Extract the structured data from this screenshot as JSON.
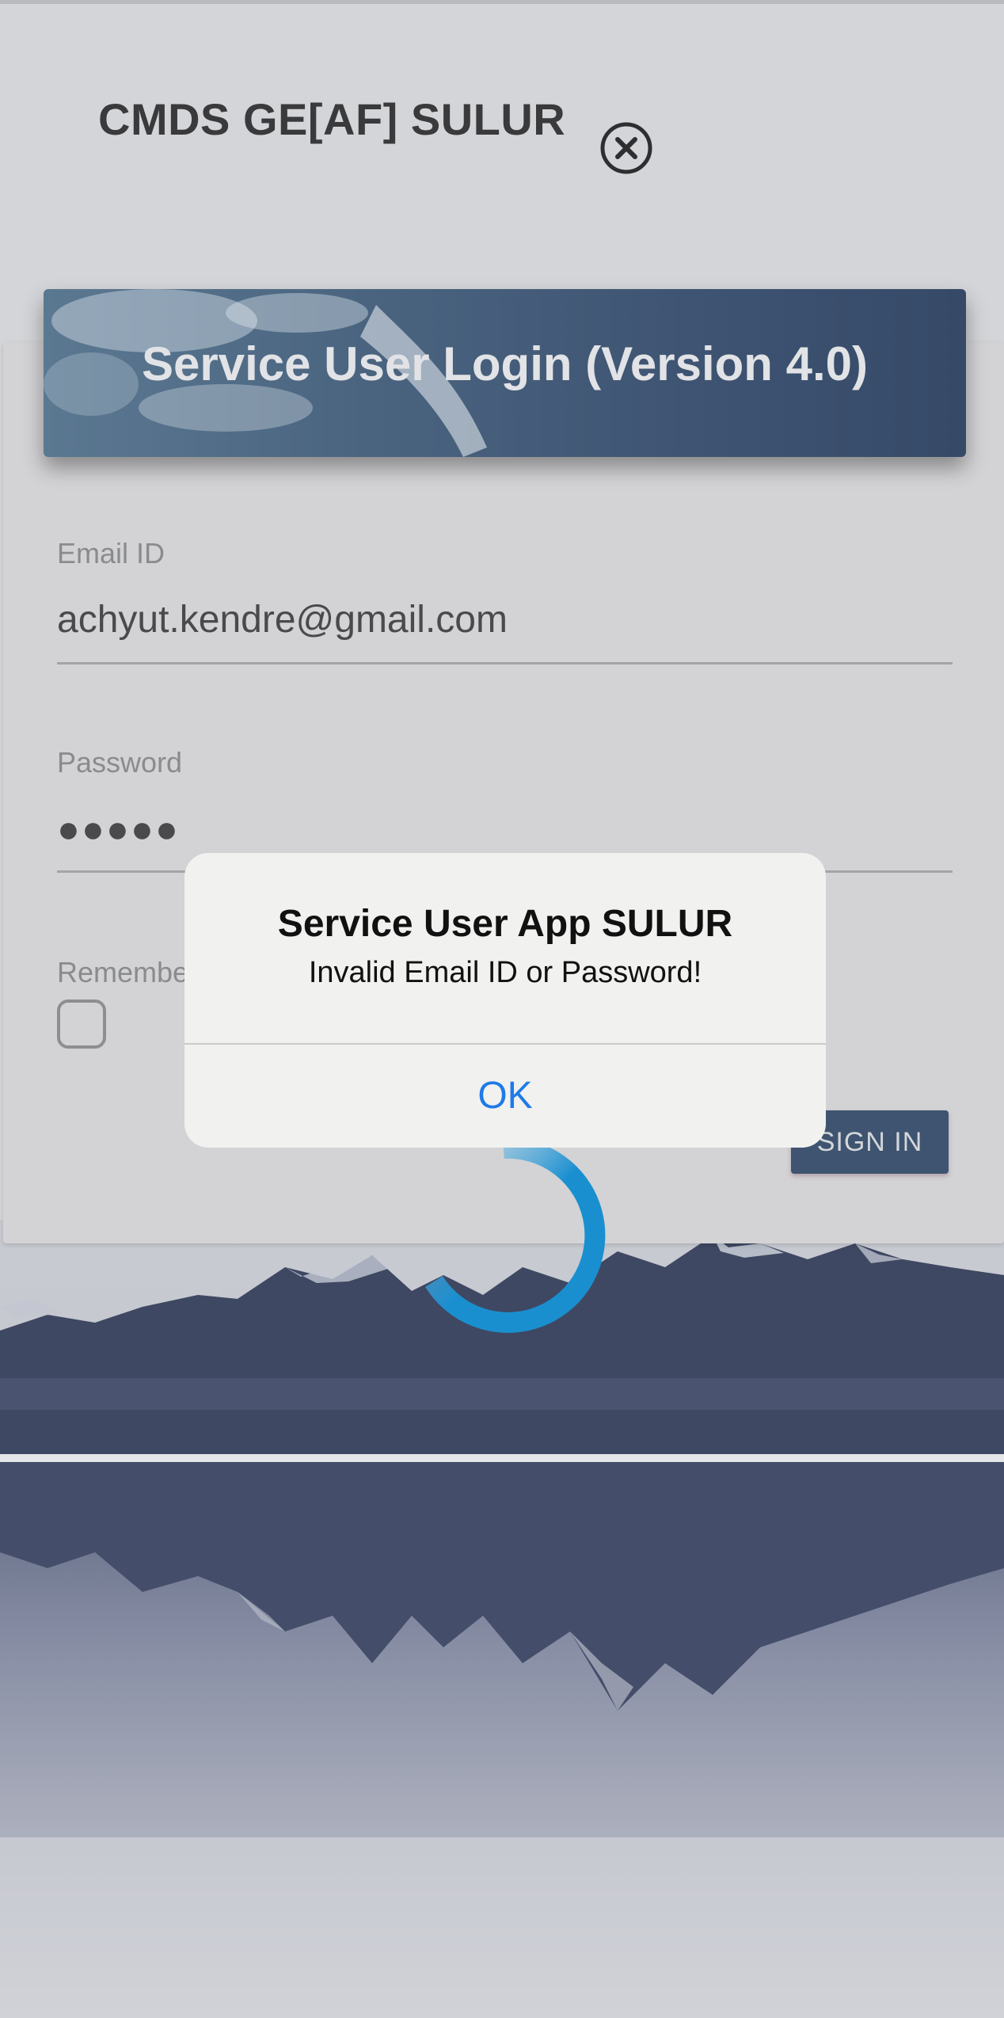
{
  "header": {
    "title": "CMDS GE[AF] SULUR",
    "close_icon": "close-circle-icon"
  },
  "login_card": {
    "banner_title": "Service User Login (Version 4.0)",
    "email": {
      "label": "Email ID",
      "value": "achyut.kendre@gmail.com"
    },
    "password": {
      "label": "Password",
      "value": "●●●●●"
    },
    "remember_label": "Remembe",
    "sign_in_label": "SIGN IN"
  },
  "dialog": {
    "title": "Service User App SULUR",
    "message": "Invalid Email ID or Password!",
    "ok_label": "OK"
  },
  "colors": {
    "accent_link": "#1f7ae8",
    "button_bg": "#3e5470",
    "spinner": "#1a8fd0"
  }
}
